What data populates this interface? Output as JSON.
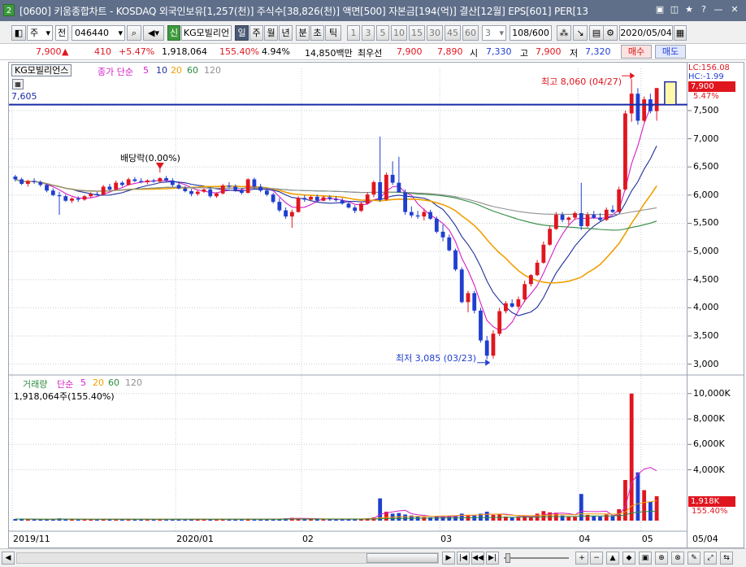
{
  "window": {
    "app_number": "2",
    "title": "[0600] 키움종합차트 - KOSDAQ 외국인보유[1,257(천)] 주식수[38,826(천)] 액면[500] 자본금[194(억)] 결산[12월] EPS[601] PER[13",
    "buttons": [
      "▣",
      "◫",
      "★",
      "?",
      "—",
      "✕"
    ]
  },
  "toolbar": {
    "type_label": "주",
    "type2_label": "전",
    "code": "046440",
    "stock_badge": "신",
    "stock_name": "KG모빌리언",
    "periods": [
      "일",
      "주",
      "월",
      "년",
      "분",
      "초",
      "틱"
    ],
    "selected_period": "일",
    "intervals": [
      "1",
      "3",
      "5",
      "10",
      "15",
      "30",
      "45",
      "60"
    ],
    "interval_value": "3",
    "count": "108/600",
    "date": "2020/05/04"
  },
  "info": {
    "price": "7,900",
    "arrow": "▲",
    "change": "410",
    "change_pct": "+5.47%",
    "volume": "1,918,064",
    "volume_pct": "155.40%",
    "turnover": "4.94%",
    "amount": "14,850백만",
    "best_quote_label": "최우선",
    "ask": "7,900",
    "bid": "7,890",
    "open_label": "시",
    "open": "7,330",
    "high_label": "고",
    "high": "7,900",
    "low_label": "저",
    "low": "7,320",
    "buy_label": "매수",
    "sell_label": "매도"
  },
  "price_panel": {
    "legend_name": "KG모빌리언스",
    "ma_title": "종가 단순",
    "ma_periods": [
      "5",
      "10",
      "20",
      "60",
      "120"
    ],
    "ma_colors": [
      "#d61ec8",
      "#1f2f9a",
      "#f0a000",
      "#2e8a3e",
      "#909090"
    ],
    "lc_label": "LC:156.08",
    "hc_label": "HC:-1.99",
    "current_price_tag": "7,900",
    "current_pct_tag": "5.47%",
    "hline_label": "7,605",
    "high_annotation": "최고 8,060 (04/27)",
    "low_annotation": "최저 3,085 (03/23)",
    "dividend_annotation": "배당락(0.00%)",
    "y_ticks": [
      "7,500",
      "7,000",
      "6,500",
      "6,000",
      "5,500",
      "5,000",
      "4,500",
      "4,000",
      "3,500",
      "3,000"
    ]
  },
  "volume_panel": {
    "legend_title": "거래량",
    "ma_title": "단순",
    "ma_periods": [
      "5",
      "20",
      "60",
      "120"
    ],
    "value_label": "1,918,064주(155.40%)",
    "tag_value": "1,918K",
    "tag_pct": "155.40%",
    "y_ticks": [
      "10,000K",
      "8,000K",
      "6,000K",
      "4,000K"
    ]
  },
  "x_axis": {
    "labels": [
      "2019/11",
      "2020/01",
      "02",
      "03",
      "04",
      "05"
    ],
    "right_label": "05/04"
  },
  "colors": {
    "up": "#e0161f",
    "down": "#1f3fd0",
    "hline": "#1a2aa8",
    "titlebar": "#5f6f8a"
  },
  "chart_data": {
    "type": "candlestick",
    "candles": [
      [
        6330,
        6360,
        6240,
        6280
      ],
      [
        6280,
        6310,
        6180,
        6200
      ],
      [
        6200,
        6270,
        6150,
        6250
      ],
      [
        6250,
        6300,
        6200,
        6230
      ],
      [
        6230,
        6260,
        6150,
        6180
      ],
      [
        6180,
        6200,
        6050,
        6080
      ],
      [
        6080,
        6120,
        5980,
        6000
      ],
      [
        6000,
        6060,
        5650,
        5980
      ],
      [
        5980,
        6010,
        5880,
        5900
      ],
      [
        5900,
        5960,
        5860,
        5940
      ],
      [
        5940,
        5980,
        5880,
        5920
      ],
      [
        5920,
        6000,
        5900,
        5980
      ],
      [
        5980,
        6050,
        5950,
        6020
      ],
      [
        6020,
        6060,
        5990,
        6010
      ],
      [
        6010,
        6180,
        6000,
        6150
      ],
      [
        6150,
        6200,
        6080,
        6100
      ],
      [
        6100,
        6260,
        6090,
        6220
      ],
      [
        6220,
        6250,
        6150,
        6180
      ],
      [
        6180,
        6310,
        6170,
        6280
      ],
      [
        6280,
        6320,
        6230,
        6250
      ],
      [
        6250,
        6300,
        6210,
        6230
      ],
      [
        6230,
        6280,
        6190,
        6260
      ],
      [
        6260,
        6290,
        6220,
        6240
      ],
      [
        6240,
        6320,
        6220,
        6300
      ],
      [
        6300,
        6340,
        6240,
        6260
      ],
      [
        6260,
        6300,
        6150,
        6180
      ],
      [
        6180,
        6220,
        6100,
        6120
      ],
      [
        6120,
        6160,
        6050,
        6070
      ],
      [
        6070,
        6110,
        5980,
        6020
      ],
      [
        6020,
        6090,
        5990,
        6060
      ],
      [
        6060,
        6120,
        6040,
        6100
      ],
      [
        6100,
        6140,
        5950,
        5980
      ],
      [
        5980,
        6050,
        5950,
        6030
      ],
      [
        6030,
        6200,
        6010,
        6170
      ],
      [
        6170,
        6230,
        6120,
        6150
      ],
      [
        6150,
        6190,
        6060,
        6090
      ],
      [
        6090,
        6120,
        6010,
        6040
      ],
      [
        6040,
        6300,
        6030,
        6280
      ],
      [
        6280,
        6310,
        6120,
        6150
      ],
      [
        6150,
        6200,
        6050,
        6080
      ],
      [
        6080,
        6120,
        5980,
        6010
      ],
      [
        6010,
        6040,
        5850,
        5880
      ],
      [
        5880,
        5950,
        5700,
        5730
      ],
      [
        5730,
        5780,
        5580,
        5620
      ],
      [
        5620,
        5740,
        5420,
        5700
      ],
      [
        5700,
        5980,
        5690,
        5950
      ],
      [
        5950,
        6000,
        5880,
        5920
      ],
      [
        5920,
        5990,
        5900,
        5970
      ],
      [
        5970,
        6010,
        5880,
        5900
      ],
      [
        5900,
        5990,
        5890,
        5960
      ],
      [
        5960,
        6000,
        5900,
        5930
      ],
      [
        5930,
        5980,
        5880,
        5910
      ],
      [
        5910,
        5950,
        5830,
        5850
      ],
      [
        5850,
        5900,
        5760,
        5780
      ],
      [
        5780,
        5820,
        5680,
        5720
      ],
      [
        5720,
        5880,
        5700,
        5850
      ],
      [
        5850,
        6050,
        5830,
        6010
      ],
      [
        6010,
        6260,
        5960,
        6230
      ],
      [
        6230,
        7040,
        5880,
        5920
      ],
      [
        5920,
        6400,
        5900,
        6360
      ],
      [
        6360,
        6600,
        6180,
        6220
      ],
      [
        6220,
        6680,
        6150,
        6050
      ],
      [
        6050,
        6100,
        5650,
        5700
      ],
      [
        5700,
        5800,
        5600,
        5640
      ],
      [
        5640,
        5720,
        5580,
        5620
      ],
      [
        5620,
        5760,
        5550,
        5700
      ],
      [
        5700,
        5740,
        5560,
        5580
      ],
      [
        5580,
        5620,
        5320,
        5350
      ],
      [
        5350,
        5480,
        5180,
        5250
      ],
      [
        5250,
        5300,
        5000,
        5020
      ],
      [
        5020,
        5050,
        4650,
        4680
      ],
      [
        4680,
        4720,
        4080,
        4100
      ],
      [
        4100,
        4300,
        3920,
        4260
      ],
      [
        4260,
        4300,
        3900,
        3950
      ],
      [
        3950,
        4000,
        3380,
        3420
      ],
      [
        3420,
        3500,
        3085,
        3150
      ],
      [
        3150,
        3600,
        3100,
        3540
      ],
      [
        3540,
        4000,
        3500,
        3940
      ],
      [
        3940,
        4120,
        3900,
        4080
      ],
      [
        4080,
        4150,
        4000,
        4020
      ],
      [
        4020,
        4200,
        3980,
        4150
      ],
      [
        4150,
        4480,
        4100,
        4420
      ],
      [
        4420,
        4600,
        4380,
        4580
      ],
      [
        4580,
        4850,
        4560,
        4800
      ],
      [
        4800,
        5180,
        4780,
        5120
      ],
      [
        5120,
        5450,
        5100,
        5400
      ],
      [
        5400,
        5700,
        5380,
        5650
      ],
      [
        5650,
        5700,
        5520,
        5560
      ],
      [
        5560,
        5620,
        5480,
        5600
      ],
      [
        5600,
        5710,
        5560,
        5680
      ],
      [
        5680,
        6220,
        5380,
        5450
      ],
      [
        5450,
        5700,
        5420,
        5650
      ],
      [
        5650,
        5720,
        5580,
        5600
      ],
      [
        5600,
        5680,
        5520,
        5560
      ],
      [
        5560,
        5780,
        5540,
        5740
      ],
      [
        5740,
        5820,
        5680,
        5700
      ],
      [
        5700,
        6150,
        5690,
        6100
      ],
      [
        6100,
        7500,
        6080,
        7450
      ],
      [
        7450,
        8060,
        7300,
        7800
      ],
      [
        7800,
        7900,
        7250,
        7320
      ],
      [
        7320,
        7750,
        7300,
        7700
      ],
      [
        7700,
        7800,
        7450,
        7490
      ],
      [
        7490,
        7900,
        7320,
        7900
      ]
    ],
    "volumes": [
      0.13,
      0.12,
      0.11,
      0.12,
      0.1,
      0.11,
      0.12,
      0.18,
      0.11,
      0.1,
      0.09,
      0.1,
      0.11,
      0.1,
      0.14,
      0.11,
      0.13,
      0.1,
      0.12,
      0.11,
      0.1,
      0.1,
      0.09,
      0.11,
      0.1,
      0.11,
      0.12,
      0.1,
      0.12,
      0.11,
      0.1,
      0.12,
      0.11,
      0.14,
      0.12,
      0.11,
      0.1,
      0.15,
      0.12,
      0.11,
      0.12,
      0.14,
      0.16,
      0.18,
      0.22,
      0.2,
      0.13,
      0.11,
      0.12,
      0.1,
      0.11,
      0.1,
      0.12,
      0.14,
      0.13,
      0.15,
      0.18,
      0.25,
      1.75,
      0.7,
      0.55,
      0.6,
      0.48,
      0.4,
      0.32,
      0.28,
      0.26,
      0.35,
      0.33,
      0.36,
      0.42,
      0.55,
      0.38,
      0.4,
      0.55,
      0.7,
      0.45,
      0.5,
      0.32,
      0.28,
      0.3,
      0.35,
      0.32,
      0.55,
      0.75,
      0.65,
      0.62,
      0.4,
      0.32,
      0.3,
      2.1,
      0.45,
      0.38,
      0.32,
      0.48,
      0.34,
      0.9,
      3.2,
      10.0,
      3.8,
      2.4,
      1.5,
      1.92
    ],
    "volume_unit": "K"
  }
}
